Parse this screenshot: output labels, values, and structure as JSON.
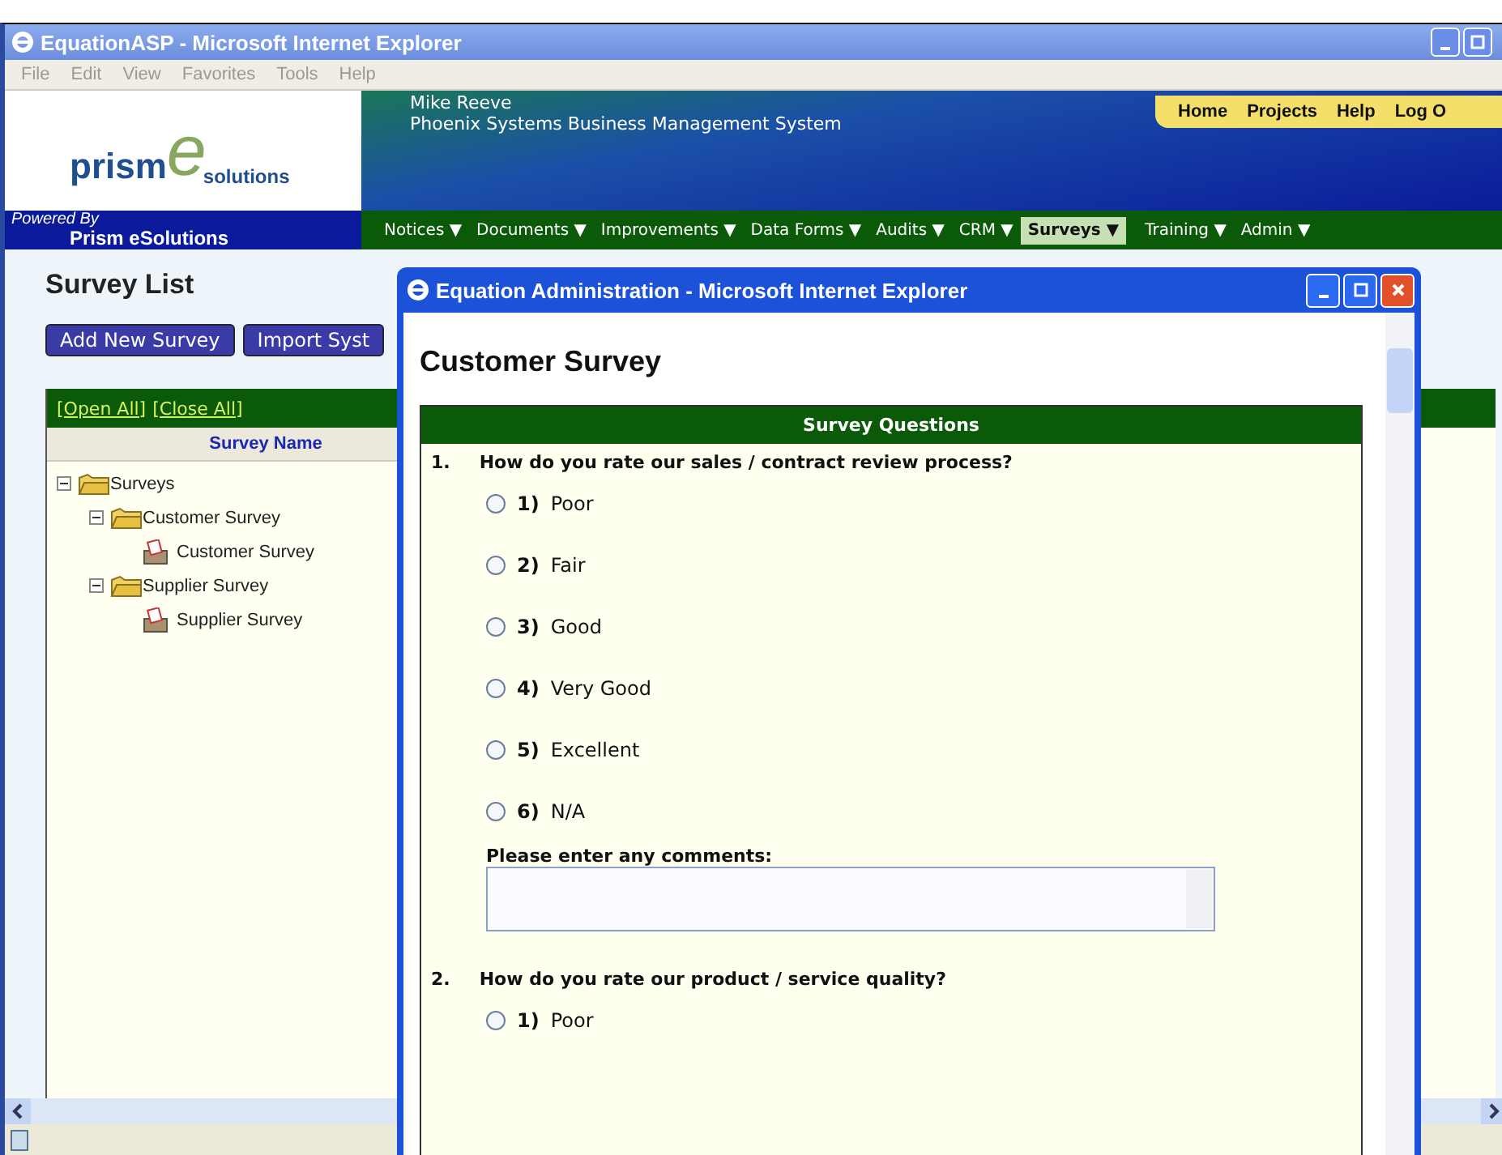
{
  "main_window": {
    "title": "EquationASP - Microsoft Internet Explorer",
    "menu": [
      "File",
      "Edit",
      "View",
      "Favorites",
      "Tools",
      "Help"
    ],
    "header": {
      "logo_word": "prism",
      "logo_letter": "e",
      "logo_sub": "solutions",
      "user": "Mike Reeve",
      "system": "Phoenix Systems Business Management System",
      "top_links": [
        "Home",
        "Projects",
        "Help",
        "Log O"
      ],
      "powered_by": "Powered By",
      "powered_name": "Prism eSolutions"
    },
    "nav": [
      {
        "label": "Notices ▼",
        "selected": false
      },
      {
        "label": "Documents ▼",
        "selected": false
      },
      {
        "label": "Improvements ▼",
        "selected": false
      },
      {
        "label": "Data Forms ▼",
        "selected": false
      },
      {
        "label": "Audits ▼",
        "selected": false
      },
      {
        "label": "CRM ▼",
        "selected": false
      },
      {
        "label": "Surveys ▼",
        "selected": true
      },
      {
        "label": "Training ▼",
        "selected": false
      },
      {
        "label": "Admin ▼",
        "selected": false
      }
    ]
  },
  "page": {
    "title": "Survey List",
    "buttons": [
      "Add New Survey",
      "Import Syst"
    ],
    "tree_links": [
      "[Open All]",
      "[Close All]"
    ],
    "column": "Survey Name",
    "tree": [
      {
        "label": "Surveys",
        "kind": "folder",
        "expanded": true,
        "children": [
          {
            "label": "Customer Survey",
            "kind": "folder",
            "expanded": true,
            "children": [
              {
                "label": "Customer Survey",
                "kind": "survey"
              }
            ]
          },
          {
            "label": "Supplier Survey",
            "kind": "folder",
            "expanded": true,
            "children": [
              {
                "label": "Supplier Survey",
                "kind": "survey"
              }
            ]
          }
        ]
      }
    ]
  },
  "popup": {
    "title": "Equation Administration - Microsoft Internet Explorer",
    "heading": "Customer Survey",
    "table_header": "Survey Questions",
    "questions": [
      {
        "number": "1.",
        "text": "How do you rate our sales / contract review process?",
        "comments_label": "Please enter any comments:",
        "options": [
          {
            "number": "1)",
            "label": "Poor",
            "selected": false
          },
          {
            "number": "2)",
            "label": "Fair",
            "selected": false
          },
          {
            "number": "3)",
            "label": "Good",
            "selected": false
          },
          {
            "number": "4)",
            "label": "Very Good",
            "selected": false
          },
          {
            "number": "5)",
            "label": "Excellent",
            "selected": false
          },
          {
            "number": "6)",
            "label": "N/A",
            "selected": false
          }
        ]
      },
      {
        "number": "2.",
        "text": "How do you rate our product / service quality?",
        "options": [
          {
            "number": "1)",
            "label": "Poor",
            "selected": false
          }
        ]
      }
    ]
  }
}
